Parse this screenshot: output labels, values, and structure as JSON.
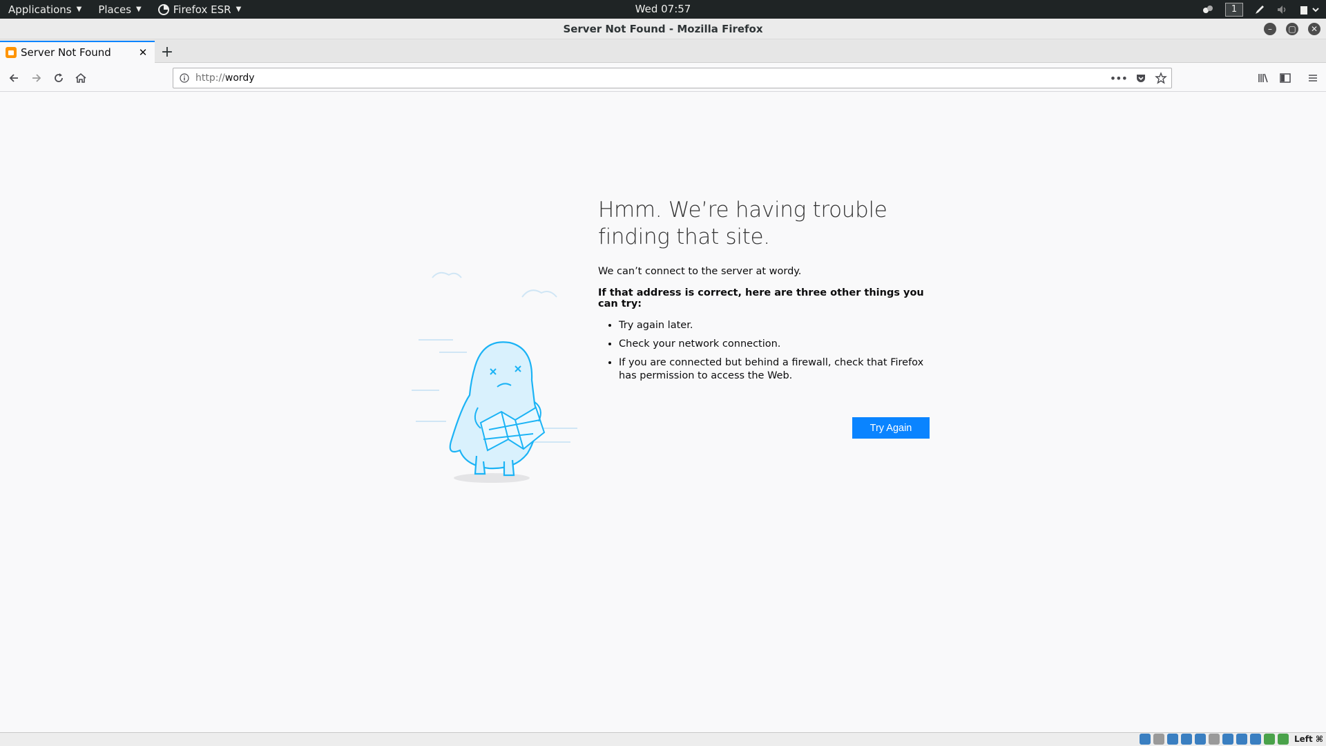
{
  "topbar": {
    "applications": "Applications",
    "places": "Places",
    "firefox": "Firefox ESR",
    "clock": "Wed 07:57",
    "workspace": "1"
  },
  "window": {
    "title": "Server Not Found - Mozilla Firefox"
  },
  "tabs": [
    {
      "label": "Server Not Found"
    }
  ],
  "navbar": {
    "url_scheme": "http://",
    "url_host": "wordy"
  },
  "error": {
    "title": "Hmm. We’re having trouble finding that site.",
    "description": "We can’t connect to the server at wordy.",
    "try_heading": "If that address is correct, here are three other things you can try:",
    "suggestions": [
      "Try again later.",
      "Check your network connection.",
      "If you are connected but behind a firewall, check that Firefox has permission to access the Web."
    ],
    "button": "Try Again"
  },
  "statusbar": {
    "host_key": "Left ⌘"
  },
  "colors": {
    "accent": "#0a84ff",
    "illustration": "#1bb3f5"
  }
}
